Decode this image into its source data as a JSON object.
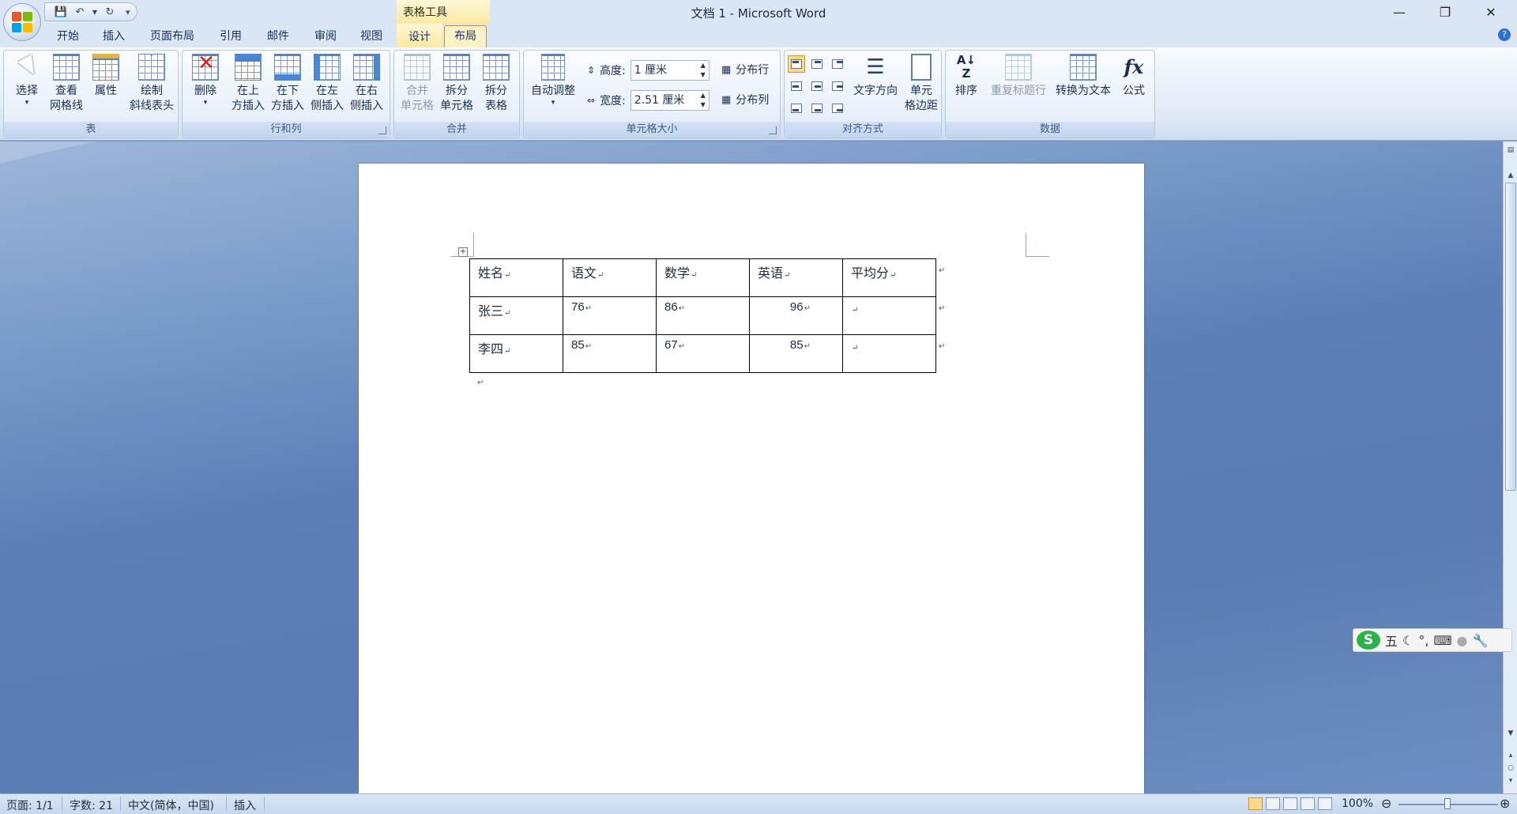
{
  "window": {
    "title": "文档 1 - Microsoft Word",
    "context_tab_group": "表格工具",
    "controls": [
      "minimize",
      "restore",
      "close"
    ]
  },
  "qat": {
    "icons": [
      "save-icon",
      "undo-icon",
      "redo-icon",
      "customize-icon"
    ]
  },
  "tabs": [
    "开始",
    "插入",
    "页面布局",
    "引用",
    "邮件",
    "审阅",
    "视图",
    "设计",
    "布局"
  ],
  "active_tab": "布局",
  "ribbon": {
    "groups": {
      "table": "表",
      "rows_cols": "行和列",
      "merge": "合并",
      "cell_size": "单元格大小",
      "alignment": "对齐方式",
      "data": "数据"
    },
    "buttons": {
      "select_1": "选择",
      "view_grid_1": "查看",
      "view_grid_2": "网格线",
      "properties": "属性",
      "draw_diag_1": "绘制",
      "draw_diag_2": "斜线表头",
      "delete": "删除",
      "insert_above_1": "在上",
      "insert_above_2": "方插入",
      "insert_below_1": "在下",
      "insert_below_2": "方插入",
      "insert_left_1": "在左",
      "insert_left_2": "侧插入",
      "insert_right_1": "在右",
      "insert_right_2": "侧插入",
      "merge_cells_1": "合并",
      "merge_cells_2": "单元格",
      "split_cells_1": "拆分",
      "split_cells_2": "单元格",
      "split_table_1": "拆分",
      "split_table_2": "表格",
      "autofit": "自动调整",
      "height_label": "高度:",
      "height_value": "1 厘米",
      "width_label": "宽度:",
      "width_value": "2.51 厘米",
      "distribute_rows": "分布行",
      "distribute_cols": "分布列",
      "text_direction": "文字方向",
      "cell_margins_1": "单元",
      "cell_margins_2": "格边距",
      "sort": "排序",
      "repeat_header": "重复标题行",
      "convert_text": "转换为文本",
      "formula": "公式"
    }
  },
  "document": {
    "table": {
      "header": [
        "姓名",
        "语文",
        "数学",
        "英语",
        "平均分"
      ],
      "rows": [
        [
          "张三",
          "76",
          "86",
          "96",
          ""
        ],
        [
          "李四",
          "85",
          "67",
          "85",
          ""
        ]
      ]
    }
  },
  "ime": {
    "logo": "S",
    "mode": "五",
    "icons": [
      "moon-icon",
      "punctuation-icon",
      "keyboard-icon",
      "user-icon",
      "wrench-icon"
    ]
  },
  "statusbar": {
    "page": "页面: 1/1",
    "words": "字数: 21",
    "language": "中文(简体，中国)",
    "mode": "插入",
    "zoom": "100%"
  },
  "colors": {
    "ribbon_bg": "#dde8f6",
    "context_tab": "#fbe8a1",
    "workspace": "#5c7fb6",
    "ime_logo": "#2cb24a"
  }
}
